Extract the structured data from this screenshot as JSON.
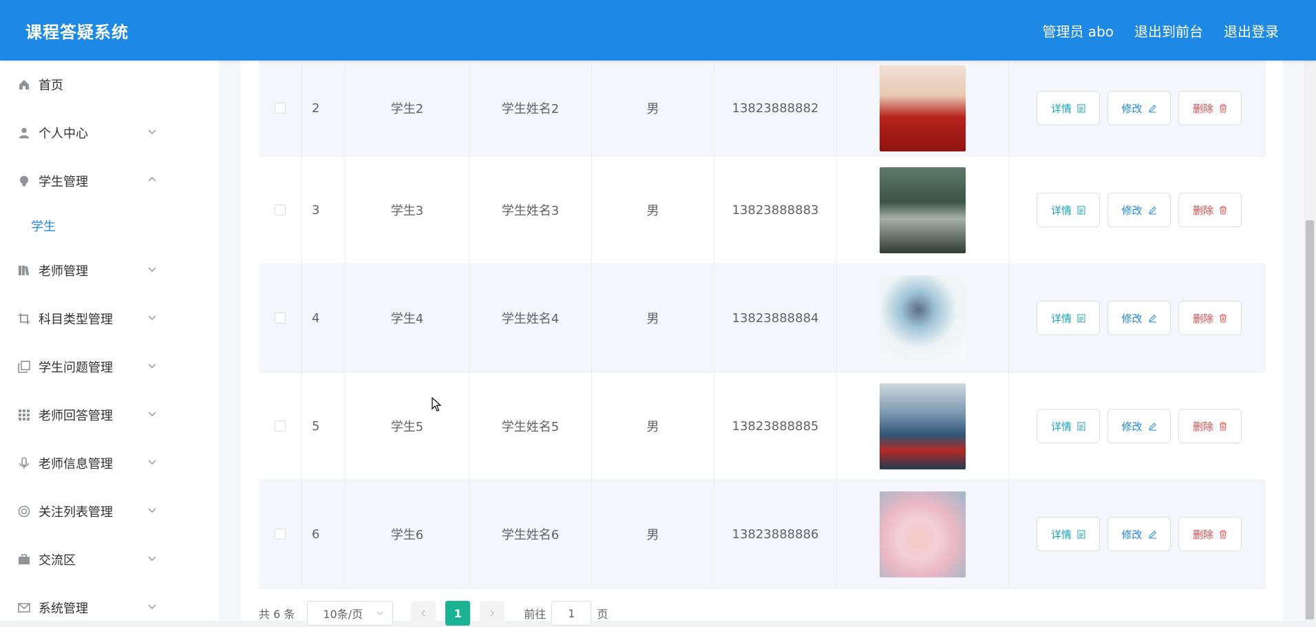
{
  "header": {
    "title": "课程答疑系统",
    "admin": "管理员 abo",
    "to_front": "退出到前台",
    "logout": "退出登录"
  },
  "sidebar": {
    "items": [
      {
        "label": "首页",
        "icon": "home-icon"
      },
      {
        "label": "个人中心",
        "icon": "user-icon"
      },
      {
        "label": "学生管理",
        "icon": "bulb-icon"
      },
      {
        "label": "老师管理",
        "icon": "book-icon"
      },
      {
        "label": "科目类型管理",
        "icon": "crop-icon"
      },
      {
        "label": "学生问题管理",
        "icon": "copy-icon"
      },
      {
        "label": "老师回答管理",
        "icon": "grid-icon"
      },
      {
        "label": "老师信息管理",
        "icon": "mic-icon"
      },
      {
        "label": "关注列表管理",
        "icon": "lifebuoy-icon"
      },
      {
        "label": "交流区",
        "icon": "briefcase-icon"
      },
      {
        "label": "系统管理",
        "icon": "mail-icon"
      }
    ],
    "subitem": "学生"
  },
  "table": {
    "rows": [
      {
        "idx": "2",
        "account": "学生2",
        "name": "学生姓名2",
        "sex": "男",
        "phone": "13823888882"
      },
      {
        "idx": "3",
        "account": "学生3",
        "name": "学生姓名3",
        "sex": "男",
        "phone": "13823888883"
      },
      {
        "idx": "4",
        "account": "学生4",
        "name": "学生姓名4",
        "sex": "男",
        "phone": "13823888884"
      },
      {
        "idx": "5",
        "account": "学生5",
        "name": "学生姓名5",
        "sex": "男",
        "phone": "13823888885"
      },
      {
        "idx": "6",
        "account": "学生6",
        "name": "学生姓名6",
        "sex": "男",
        "phone": "13823888886"
      }
    ],
    "actions": {
      "detail": "详情",
      "edit": "修改",
      "delete": "删除"
    }
  },
  "pagination": {
    "total": "共 6 条",
    "page_size": "10条/页",
    "current_page": "1",
    "goto_label": "前往",
    "goto_value": "1",
    "page_suffix": "页"
  },
  "colors": {
    "primary": "#1e88e5",
    "detail": "#17a2b8",
    "delete": "#e5474a",
    "active_page": "#1ab394"
  }
}
